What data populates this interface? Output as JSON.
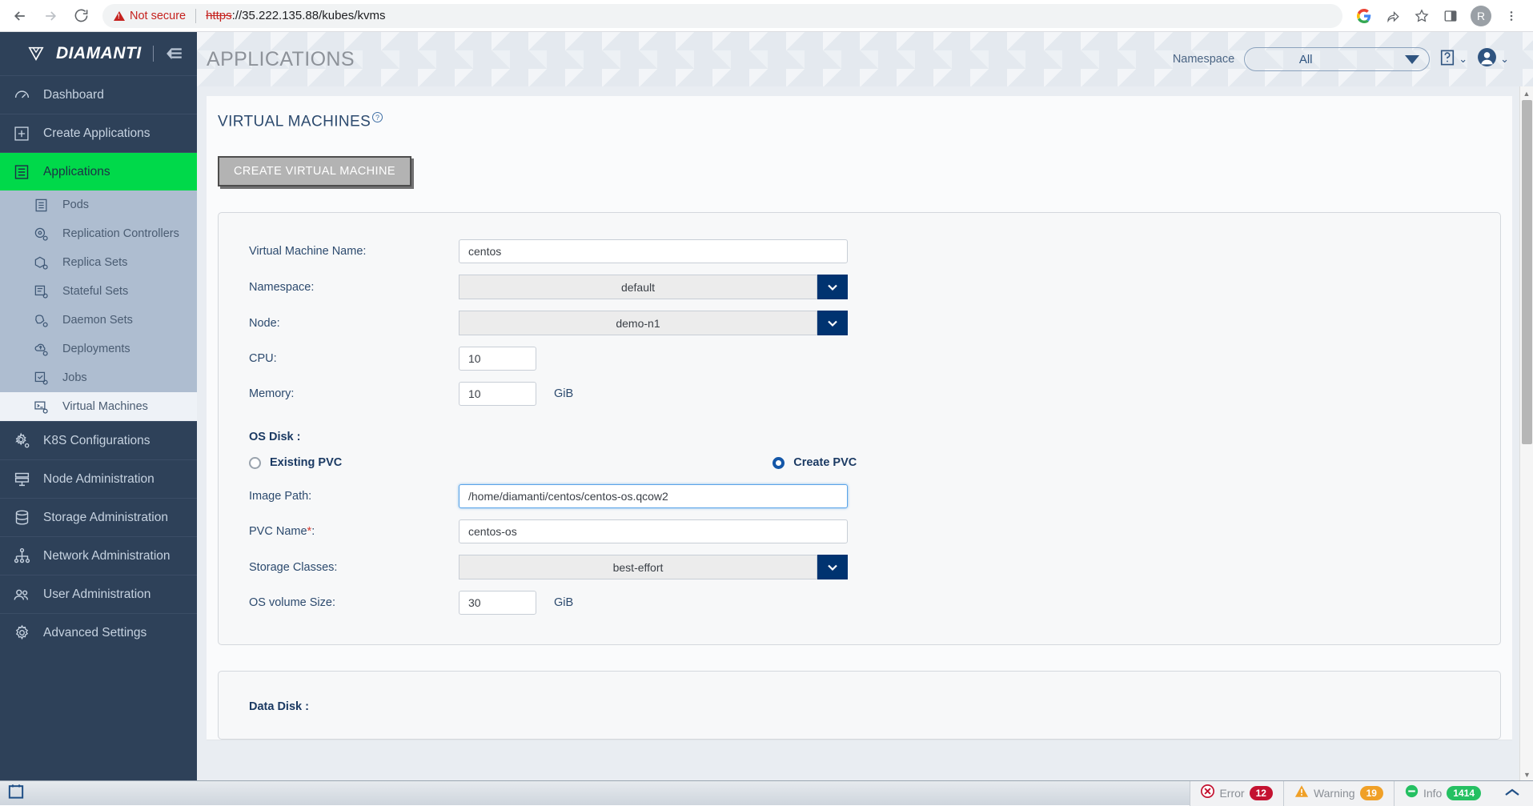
{
  "browser": {
    "back_icon": "arrow-left-icon",
    "forward_icon": "arrow-right-icon",
    "reload_icon": "reload-icon",
    "security_label": "Not secure",
    "url_scheme": "https",
    "url_rest": "://35.222.135.88/kubes/kvms",
    "google_icon": "google-icon",
    "share_icon": "share-icon",
    "bookmark_icon": "star-icon",
    "sidepanel_icon": "side-panel-icon",
    "profile_initial": "R",
    "menu_icon": "kebab-menu-icon"
  },
  "sidebar": {
    "logo_text": "DIAMANTI",
    "logo_icon": "diamond-logo-icon",
    "collapse_icon": "collapse-sidebar-icon",
    "items": [
      {
        "label": "Dashboard",
        "icon": "gauge-icon",
        "active": false
      },
      {
        "label": "Create Applications",
        "icon": "plus-box-icon",
        "active": false
      },
      {
        "label": "Applications",
        "icon": "list-box-icon",
        "active": true
      }
    ],
    "subitems": [
      {
        "label": "Pods",
        "icon": "pods-icon",
        "selected": false
      },
      {
        "label": "Replication Controllers",
        "icon": "replication-controllers-icon",
        "selected": false
      },
      {
        "label": "Replica Sets",
        "icon": "replica-sets-icon",
        "selected": false
      },
      {
        "label": "Stateful Sets",
        "icon": "stateful-sets-icon",
        "selected": false
      },
      {
        "label": "Daemon Sets",
        "icon": "daemon-sets-icon",
        "selected": false
      },
      {
        "label": "Deployments",
        "icon": "deployments-icon",
        "selected": false
      },
      {
        "label": "Jobs",
        "icon": "jobs-icon",
        "selected": false
      },
      {
        "label": "Virtual Machines",
        "icon": "virtual-machines-icon",
        "selected": true
      }
    ],
    "items_bottom": [
      {
        "label": "K8S Configurations",
        "icon": "gear-icon"
      },
      {
        "label": "Node Administration",
        "icon": "server-icon"
      },
      {
        "label": "Storage Administration",
        "icon": "database-icon"
      },
      {
        "label": "Network Administration",
        "icon": "network-icon"
      },
      {
        "label": "User Administration",
        "icon": "users-icon"
      },
      {
        "label": "Advanced Settings",
        "icon": "settings-gear-icon"
      }
    ]
  },
  "header": {
    "page_title": "APPLICATIONS",
    "namespace_label": "Namespace",
    "namespace_value": "All",
    "help_icon": "help-book-icon",
    "user_icon": "user-avatar-icon",
    "chevron": "⌄"
  },
  "panel": {
    "section_title": "VIRTUAL MACHINES",
    "help_marker": "?",
    "create_button": "CREATE VIRTUAL MACHINE"
  },
  "form": {
    "vm_name_label": "Virtual Machine Name:",
    "vm_name_value": "centos",
    "namespace_label": "Namespace:",
    "namespace_value": "default",
    "node_label": "Node:",
    "node_value": "demo-n1",
    "cpu_label": "CPU:",
    "cpu_value": "10",
    "memory_label": "Memory:",
    "memory_value": "10",
    "memory_unit": "GiB",
    "os_disk_title": "OS Disk :",
    "radio_existing": "Existing PVC",
    "radio_create": "Create PVC",
    "image_path_label": "Image Path:",
    "image_path_value": "/home/diamanti/centos/centos-os.qcow2",
    "pvc_name_label": "PVC Name",
    "pvc_name_req": "*",
    "pvc_name_colon": ":",
    "pvc_name_value": "centos-os",
    "storage_classes_label": "Storage Classes:",
    "storage_classes_value": "best-effort",
    "os_volume_label": "OS volume Size:",
    "os_volume_value": "30",
    "os_volume_unit": "GiB",
    "data_disk_title": "Data Disk :"
  },
  "statusbar": {
    "calendar_icon": "calendar-icon",
    "error_label": "Error",
    "error_count": "12",
    "error_color": "#c41230",
    "warning_label": "Warning",
    "warning_count": "19",
    "warning_color": "#f0a027",
    "info_label": "Info",
    "info_count": "1414",
    "info_color": "#25c062",
    "expand_icon": "chevron-up-icon"
  }
}
